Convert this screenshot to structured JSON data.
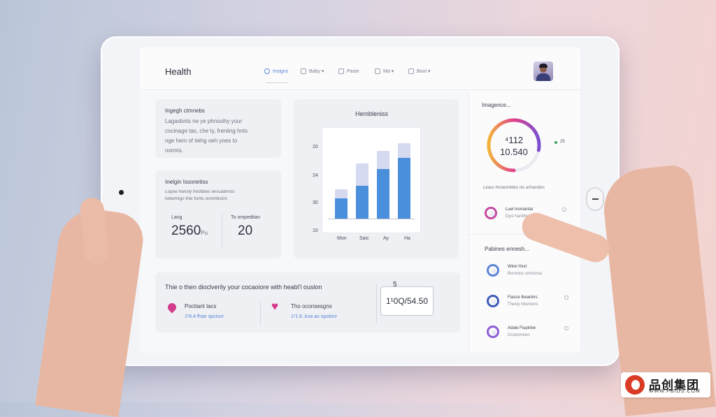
{
  "header": {
    "app_title": "Health",
    "nav": [
      {
        "label": "Insigns",
        "active": true
      },
      {
        "label": "Baby ▾"
      },
      {
        "label": "Pasie"
      },
      {
        "label": "Ma ▾"
      },
      {
        "label": "Bool ▾"
      }
    ]
  },
  "left_top_card": {
    "title": "Ingegh ctmnebs",
    "text": "Lagasbnts ne ye phnssihy your\ncocinage tas, che ty, freniing hnts\nnge hem of teihg oeh yoes to\nnonnis."
  },
  "left_mid_card": {
    "title": "Inelgin Issonetiss",
    "text": "Lopse hansly lntobbes wrscabmos\ntobwmigs thie fonts oonmbsion",
    "stat1": {
      "label": "Lang",
      "value": "2560",
      "unit": "Pu"
    },
    "stat2": {
      "label": "To ompeditan",
      "value": "20"
    }
  },
  "chart_card": {
    "title": "Hembleniss",
    "y_ticks": [
      "20",
      "24",
      "30",
      "10"
    ],
    "x_ticks": [
      "Mon",
      "Saic",
      "Ay",
      "Ha"
    ]
  },
  "chart_data": {
    "type": "bar",
    "title": "Hembleniss",
    "categories": [
      "Mon",
      "Saic",
      "Ay",
      "Ha"
    ],
    "series": [
      {
        "values": [
          11,
          18,
          27,
          33
        ]
      },
      {
        "values": [
          16,
          30,
          37,
          41
        ]
      }
    ],
    "ylim": [
      0,
      45
    ]
  },
  "right_panel": {
    "title": "Imagence...",
    "gauge": {
      "line1": "⁴112",
      "line2": "10.540",
      "progress": 0.78
    },
    "gauge_note": "Leasc hnoesmldes nic arlnandon",
    "gauge_badge": "25",
    "item_top": {
      "title": "Luel Insmantar",
      "sub": "Dysl hanbhcnes"
    },
    "section_title": "Pabines ennesh...",
    "items": [
      {
        "title": "Wirel Hxxt",
        "sub": "Boomioc onnsinsa"
      },
      {
        "title": "Fiasce Ibeanbrs",
        "sub": "Thesly hbsnlons"
      },
      {
        "title": "Adale Fiupinbe",
        "sub": "Dcsesmeen"
      }
    ],
    "colors": {
      "gauge_start": "#7b4fd1",
      "gauge_mid": "#e0418a",
      "gauge_end": "#f2b33b",
      "gauge_track": "#5b86d6"
    }
  },
  "bottom_card": {
    "headline": "Thie o then dioclverily your cocaoiore with heabl'l ouslon",
    "item1": {
      "title": "Poctiant lacs",
      "sub": "1¹8 A fhae spcioor"
    },
    "item2": {
      "title": "Tho oconsesgns",
      "sub": "1¹1.8 ,koa ao opolonr"
    },
    "badge": "5",
    "value": "1¹0Q/54.50"
  },
  "watermark": {
    "brand": "品创集团",
    "url": "WWW.PBIDS.COM"
  }
}
